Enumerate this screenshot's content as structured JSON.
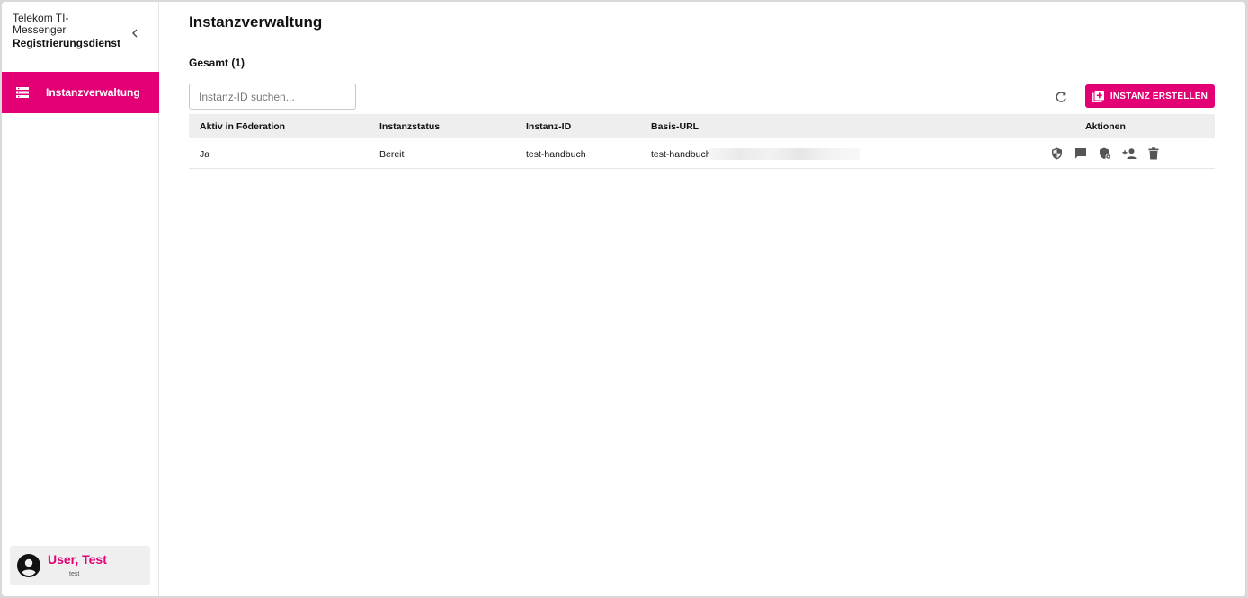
{
  "sidebar": {
    "brand_line1": "Telekom TI-",
    "brand_line2": "Messenger",
    "brand_line3": "Registrierungsdienst",
    "nav_items": [
      {
        "label": "Instanzverwaltung",
        "icon": "list-icon",
        "active": true
      }
    ],
    "user": {
      "name": "User, Test",
      "login": "test",
      "icon": "account-circle-icon"
    }
  },
  "main": {
    "title": "Instanzverwaltung",
    "total_label": "Gesamt (1)",
    "search_placeholder": "Instanz-ID suchen...",
    "create_button_label": "INSTANZ ERSTELLEN",
    "table": {
      "headers": [
        "Aktiv in Föderation",
        "Instanzstatus",
        "Instanz-ID",
        "Basis-URL",
        "Aktionen"
      ],
      "rows": [
        {
          "aktiv": "Ja",
          "status": "Bereit",
          "instanz_id": "test-handbuch",
          "basis_url": "test-handbuch",
          "actions": [
            "shield-icon",
            "message-icon",
            "shield-settings-icon",
            "add-user-icon",
            "delete-icon"
          ]
        }
      ]
    }
  },
  "colors": {
    "accent": "#e20074",
    "header_bg": "#eeeeee"
  }
}
